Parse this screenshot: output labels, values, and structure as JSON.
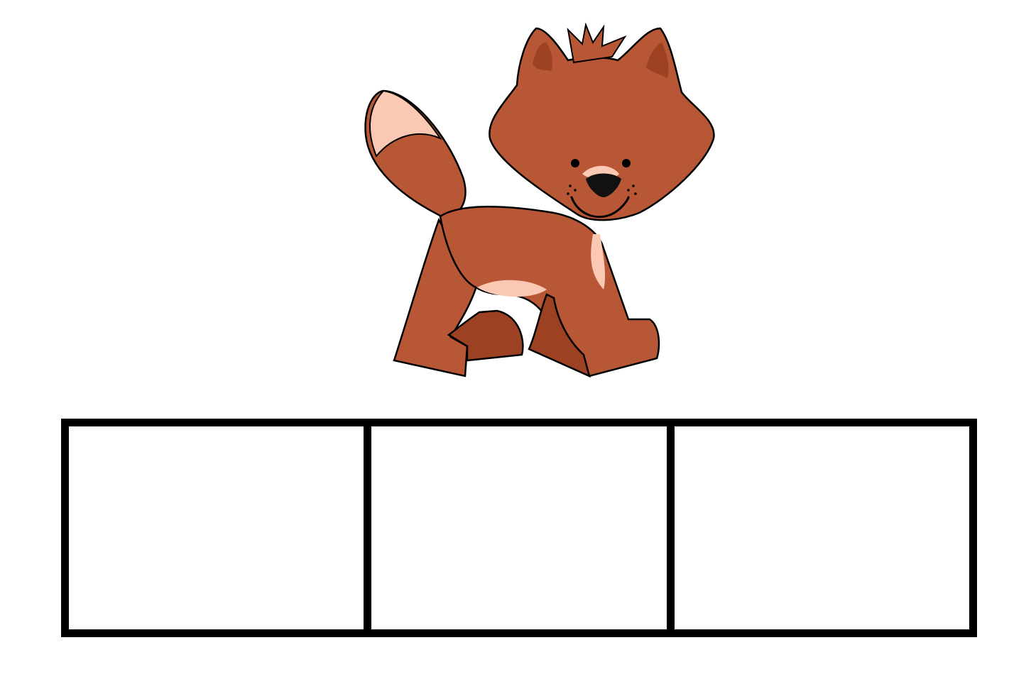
{
  "illustration": {
    "icon": "fox-icon",
    "colors": {
      "fur": "#b85735",
      "fur_dark": "#9c4223",
      "light": "#fbc9b3",
      "outline": "#000000"
    }
  },
  "sound_boxes": {
    "count": 3,
    "border_color": "#000000",
    "cells": [
      "",
      "",
      ""
    ]
  }
}
